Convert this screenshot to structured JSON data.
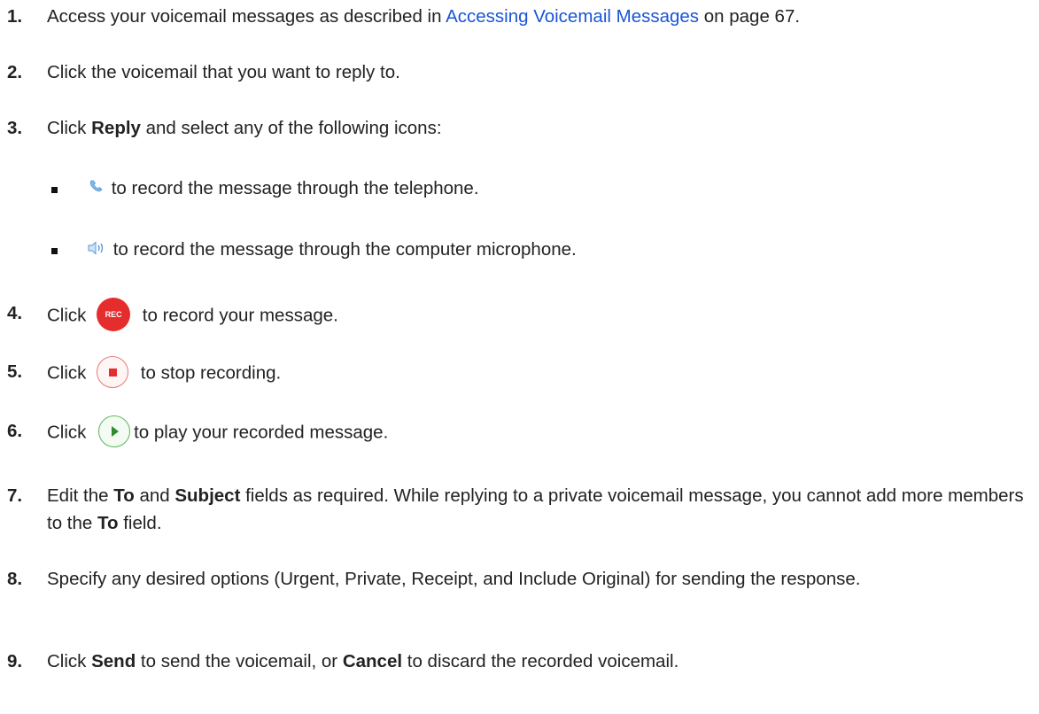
{
  "steps": [
    {
      "num": "1.",
      "pre": "Access your voicemail messages as described in ",
      "link": "Accessing Voicemail Messages",
      "post": " on page 67."
    },
    {
      "num": "2.",
      "text": "Click the voicemail that you want to reply to."
    },
    {
      "num": "3.",
      "pre": "Click ",
      "bold": "Reply",
      "post": " and select any of the following icons:"
    },
    {
      "num": "4.",
      "pre": "Click ",
      "icon_label": "REC",
      "post": " to record your message."
    },
    {
      "num": "5.",
      "pre": "Click ",
      "post": " to stop recording."
    },
    {
      "num": "6.",
      "pre": "Click ",
      "post": "to play your recorded message."
    },
    {
      "num": "7.",
      "t1": "Edit the ",
      "b1": "To",
      "t2": " and ",
      "b2": "Subject",
      "t3": " fields as required. While replying to a private voicemail message, you cannot add more members to the ",
      "b3": "To",
      "t4": " field."
    },
    {
      "num": "8.",
      "text": "Specify any desired options (Urgent, Private, Receipt, and Include Original) for sending the response."
    },
    {
      "num": "9.",
      "t1": "Click ",
      "b1": "Send",
      "t2": " to send the voicemail, or ",
      "b2": "Cancel",
      "t3": " to discard the recorded voicemail."
    }
  ],
  "bullets": [
    {
      "icon": "phone-icon",
      "text": " to record the message through the telephone."
    },
    {
      "icon": "speaker-icon",
      "text": " to record the message through the computer microphone."
    }
  ],
  "colors": {
    "link": "#1a55d6",
    "rec": "#e52d2d",
    "play": "#2e8b2e"
  }
}
